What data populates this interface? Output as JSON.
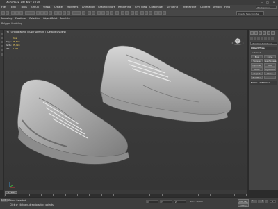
{
  "title": "... Autodesk 3ds Max 2020",
  "menu": [
    "File",
    "Edit",
    "Tools",
    "Group",
    "Views",
    "Create",
    "Modifiers",
    "Animation",
    "Graph Editors",
    "Rendering",
    "Civil View",
    "Customize",
    "Scripting",
    "Interactive",
    "Content",
    "Arnold",
    "Help"
  ],
  "workspace": "Workspaces: Default",
  "selection_set": "Create Selection Se",
  "ribbon": {
    "tabs": [
      "Modeling",
      "Freeform",
      "Selection",
      "Object Paint",
      "Populate"
    ],
    "subtitle": "Polygon Modeling"
  },
  "viewport": {
    "label": "[+] [Orthographic ] [User Defined ] [Default Shading ]",
    "stats": [
      {
        "key": "",
        "value": "Total"
      },
      {
        "key": "Polys:",
        "value": "85,608"
      },
      {
        "key": "Verts:",
        "value": "85,798"
      },
      {
        "key": "FPS:",
        "value": "7.211"
      }
    ]
  },
  "command_panel": {
    "dropdown": "Standard Primitives",
    "rollout_object_type": "Object Type",
    "autogrid": "AutoGrid",
    "buttons": [
      "Box",
      "Cone",
      "Sphere",
      "GeoSphere",
      "Cylinder",
      "Tube",
      "Torus",
      "Pyramid",
      "Teapot",
      "Plane",
      "TextPlus",
      ""
    ],
    "rollout_name_color": "Name and Color"
  },
  "timeline": {
    "slider": "0 / 100",
    "ticks": [
      "0",
      "5",
      "10",
      "15",
      "20",
      "25",
      "30",
      "35",
      "40",
      "45",
      "50",
      "55",
      "60",
      "65",
      "70",
      "75",
      "80",
      "85",
      "90",
      "95",
      "100"
    ]
  },
  "status": {
    "maxscript": "MAXScript",
    "line1": "None Selected",
    "line2": "Click or click-and-drag to select objects",
    "x": "X:",
    "y": "Y:",
    "z": "Z:",
    "grid": "Grid = 10,0cm",
    "autokey": "Auto Key",
    "setkey": "Set Key",
    "frame": "0"
  }
}
